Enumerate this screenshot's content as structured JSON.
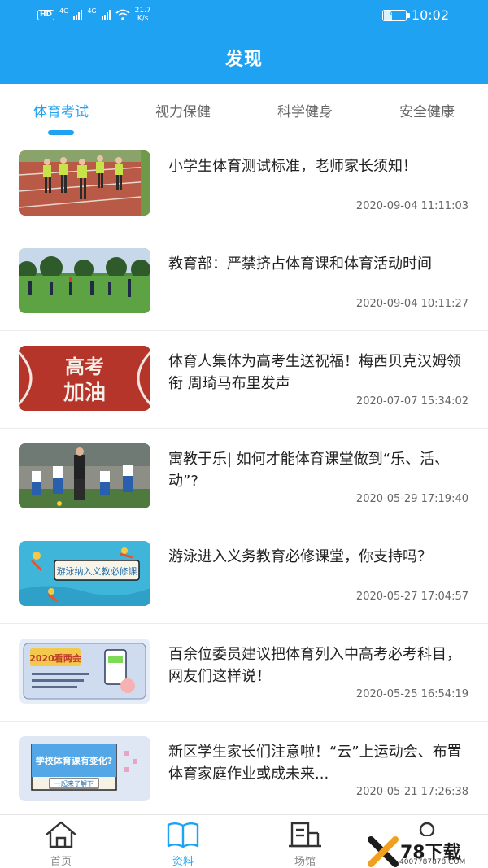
{
  "status_bar": {
    "sim_badge": "HD",
    "net1": "4G",
    "net2": "4G",
    "speed_value": "21.7",
    "speed_unit": "K/s",
    "battery": "41",
    "time": "10:02"
  },
  "header": {
    "title": "发现"
  },
  "tabs": [
    {
      "label": "体育考试",
      "active": true
    },
    {
      "label": "视力保健",
      "active": false
    },
    {
      "label": "科学健身",
      "active": false
    },
    {
      "label": "安全健康",
      "active": false
    }
  ],
  "articles": [
    {
      "title": "小学生体育测试标准，老师家长须知！",
      "time": "2020-09-04 11:11:03"
    },
    {
      "title": "教育部：严禁挤占体育课和体育活动时间",
      "time": "2020-09-04 10:11:27"
    },
    {
      "title": "体育人集体为高考生送祝福！梅西贝克汉姆领衔 周琦马布里发声",
      "time": "2020-07-07 15:34:02",
      "thumb_text1": "高考",
      "thumb_text2": "加油"
    },
    {
      "title": "寓教于乐| 如何才能体育课堂做到“乐、活、动”?",
      "time": "2020-05-29 17:19:40"
    },
    {
      "title": "游泳进入义务教育必修课堂，你支持吗？",
      "time": "2020-05-27 17:04:57",
      "thumb_text1": "游泳纳入义教必修课"
    },
    {
      "title": "百余位委员建议把体育列入中高考必考科目，网友们这样说！",
      "time": "2020-05-25 16:54:19",
      "thumb_text1": "2020看两会"
    },
    {
      "title": "新区学生家长们注意啦！“云”上运动会、布置体育家庭作业或成未来...",
      "time": "2020-05-21 17:26:38",
      "thumb_text1": "学校体育课有变化?",
      "thumb_text2": "一起来了解下"
    }
  ],
  "bottom_nav": [
    {
      "label": "首页",
      "icon": "home-icon",
      "active": false
    },
    {
      "label": "资料",
      "icon": "book-icon",
      "active": true
    },
    {
      "label": "场馆",
      "icon": "building-icon",
      "active": false
    },
    {
      "label": "",
      "icon": "user-icon",
      "active": false
    }
  ],
  "watermark": {
    "text": "78下载",
    "url": "4007787878.COM"
  },
  "colors": {
    "accent": "#1fa2f2",
    "text": "#222222",
    "muted": "#666666"
  }
}
